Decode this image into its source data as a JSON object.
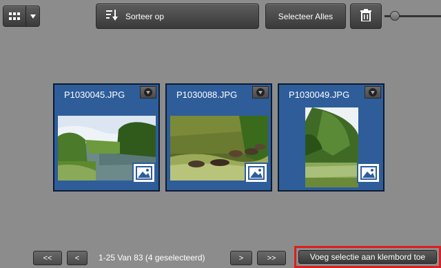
{
  "toolbar": {
    "view_toggle_icon": "grid-icon",
    "sort_label": "Sorteer op",
    "select_all_label": "Selecteer Alles",
    "delete_icon": "trash-icon"
  },
  "photos": [
    {
      "filename": "P1030045.JPG"
    },
    {
      "filename": "P1030088.JPG"
    },
    {
      "filename": "P1030049.JPG"
    }
  ],
  "pagination": {
    "first_label": "<<",
    "prev_label": "<",
    "status": "1-25 Van 83  (4 geselecteerd)",
    "next_label": ">",
    "last_label": ">>"
  },
  "actions": {
    "copy_selection_label": "Voeg selectie aan klembord toe"
  },
  "colors": {
    "background": "#8c8c8c",
    "card_blue": "#2e5d9a",
    "highlight_red": "#d91f1f"
  }
}
